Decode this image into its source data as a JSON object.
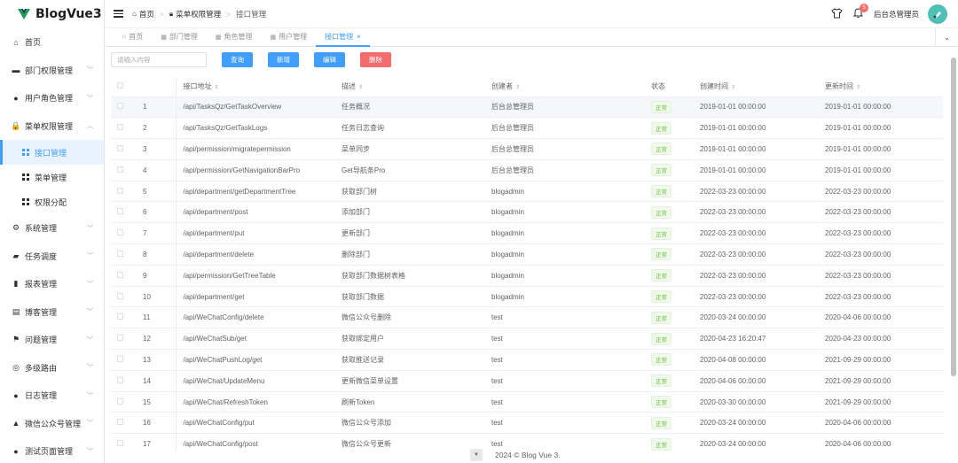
{
  "brand": {
    "name": "BlogVue3",
    "color": "#1f9d55"
  },
  "sidebar": {
    "items": [
      {
        "label": "首页",
        "icon": "home-icon",
        "glyph": "⌂",
        "arrow": false
      },
      {
        "label": "部门权限管理",
        "icon": "briefcase-icon",
        "glyph": "▬",
        "arrow": true
      },
      {
        "label": "用户角色管理",
        "icon": "user-icon",
        "glyph": "●",
        "arrow": true
      },
      {
        "label": "菜单权限管理",
        "icon": "lock-icon",
        "glyph": "🔒",
        "arrow": true,
        "open": true
      }
    ],
    "subitems": [
      {
        "label": "接口管理",
        "active": true
      },
      {
        "label": "菜单管理",
        "active": false
      },
      {
        "label": "权限分配",
        "active": false
      }
    ],
    "items2": [
      {
        "label": "系统管理",
        "icon": "gear-icon",
        "glyph": "⚙"
      },
      {
        "label": "任务调度",
        "icon": "task-icon",
        "glyph": "▰"
      },
      {
        "label": "报表管理",
        "icon": "chart-icon",
        "glyph": "▮"
      },
      {
        "label": "博客管理",
        "icon": "blog-icon",
        "glyph": "▤"
      },
      {
        "label": "问题管理",
        "icon": "flag-icon",
        "glyph": "⚑"
      },
      {
        "label": "多级路由",
        "icon": "route-icon",
        "glyph": "◎"
      },
      {
        "label": "日志管理",
        "icon": "log-icon",
        "glyph": "●"
      },
      {
        "label": "微信公众号管理",
        "icon": "wechat-icon",
        "glyph": "▲"
      },
      {
        "label": "测试页面管理",
        "icon": "test-icon",
        "glyph": "●"
      }
    ]
  },
  "header": {
    "breadcrumb": [
      "首页",
      "菜单权限管理",
      "接口管理"
    ],
    "notification_count": "5",
    "username": "后台总管理员"
  },
  "tabs": [
    {
      "label": "首页",
      "active": false
    },
    {
      "label": "部门管理",
      "active": false
    },
    {
      "label": "角色管理",
      "active": false
    },
    {
      "label": "用户管理",
      "active": false
    },
    {
      "label": "接口管理",
      "active": true
    }
  ],
  "toolbar": {
    "search_placeholder": "请输入内容",
    "query_label": "查询",
    "add_label": "新增",
    "edit_label": "编辑",
    "delete_label": "删除"
  },
  "table": {
    "columns": [
      "接口地址",
      "描述",
      "创建者",
      "状态",
      "创建时间",
      "更新时间"
    ],
    "rows": [
      [
        "1",
        "/api/TasksQz/GetTaskOverview",
        "任务概况",
        "后台总管理员",
        "正常",
        "2019-01-01 00:00:00",
        "2019-01-01 00:00:00"
      ],
      [
        "2",
        "/api/TasksQz/GetTaskLogs",
        "任务日志查询",
        "后台总管理员",
        "正常",
        "2019-01-01 00:00:00",
        "2019-01-01 00:00:00"
      ],
      [
        "3",
        "/api/permission/migratepermission",
        "菜单同步",
        "后台总管理员",
        "正常",
        "2019-01-01 00:00:00",
        "2019-01-01 00:00:00"
      ],
      [
        "4",
        "/api/permission/GetNavigationBarPro",
        "Get导航条Pro",
        "后台总管理员",
        "正常",
        "2019-01-01 00:00:00",
        "2019-01-01 00:00:00"
      ],
      [
        "5",
        "/api/department/getDepartmentTree",
        "获取部门树",
        "blogadmin",
        "正常",
        "2022-03-23 00:00:00",
        "2022-03-23 00:00:00"
      ],
      [
        "6",
        "/api/department/post",
        "添加部门",
        "blogadmin",
        "正常",
        "2022-03-23 00:00:00",
        "2022-03-23 00:00:00"
      ],
      [
        "7",
        "/api/department/put",
        "更新部门",
        "blogadmin",
        "正常",
        "2022-03-23 00:00:00",
        "2022-03-23 00:00:00"
      ],
      [
        "8",
        "/api/department/delete",
        "删除部门",
        "blogadmin",
        "正常",
        "2022-03-23 00:00:00",
        "2022-03-23 00:00:00"
      ],
      [
        "9",
        "/api/permission/GetTreeTable",
        "获取部门数据树表格",
        "blogadmin",
        "正常",
        "2022-03-23 00:00:00",
        "2022-03-23 00:00:00"
      ],
      [
        "10",
        "/api/department/get",
        "获取部门数据",
        "blogadmin",
        "正常",
        "2022-03-23 00:00:00",
        "2022-03-23 00:00:00"
      ],
      [
        "11",
        "/api/WeChatConfig/delete",
        "微信公众号删除",
        "test",
        "正常",
        "2020-03-24 00:00:00",
        "2020-04-06 00:00:00"
      ],
      [
        "12",
        "/api/WeChatSub/get",
        "获取绑定用户",
        "test",
        "正常",
        "2020-04-23 16:20:47",
        "2020-04-23 00:00:00"
      ],
      [
        "13",
        "/api/WeChatPushLog/get",
        "获取推送记录",
        "test",
        "正常",
        "2020-04-08 00:00:00",
        "2021-09-29 00:00:00"
      ],
      [
        "14",
        "/api/WeChat/UpdateMenu",
        "更新微信菜单设置",
        "test",
        "正常",
        "2020-04-06 00:00:00",
        "2021-09-29 00:00:00"
      ],
      [
        "15",
        "/api/WeChat/RefreshToken",
        "刷新Token",
        "test",
        "正常",
        "2020-03-30 00:00:00",
        "2021-09-29 00:00:00"
      ],
      [
        "16",
        "/api/WeChatConfig/put",
        "微信公众号添加",
        "test",
        "正常",
        "2020-03-24 00:00:00",
        "2020-04-06 00:00:00"
      ],
      [
        "17",
        "/api/WeChatConfig/post",
        "微信公众号更新",
        "test",
        "正常",
        "2020-03-24 00:00:00",
        "2020-04-06 00:00:00"
      ]
    ]
  },
  "footer": {
    "text": "2024 © Blog Vue 3."
  },
  "colors": {
    "accent": "#409eff",
    "danger": "#f56c6c",
    "success": "#67c23a"
  }
}
